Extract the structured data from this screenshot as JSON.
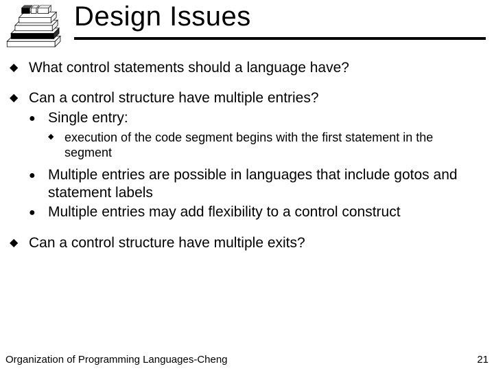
{
  "title": "Design Issues",
  "bullets": {
    "b1": "What control statements should a language have?",
    "b2": "Can a control structure have multiple entries?",
    "b2_1": "Single entry:",
    "b2_1_1": "execution of the code segment begins with the first statement in the segment",
    "b2_2": "Multiple entries are possible in languages that include gotos and statement labels",
    "b2_3": "Multiple entries may add flexibility to a control construct",
    "b3": "Can a control structure have multiple exits?"
  },
  "footer": {
    "left": "Organization of Programming Languages-Cheng",
    "right": "21"
  },
  "icon": {
    "layers": [
      "",
      "",
      "",
      "",
      ""
    ]
  }
}
